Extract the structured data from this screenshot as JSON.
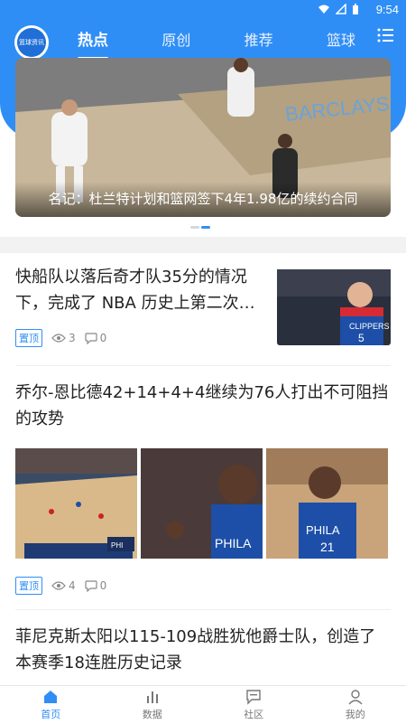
{
  "status": {
    "time": "9:54"
  },
  "header": {
    "logo_text": "篮球资讯",
    "tabs": [
      {
        "label": "热点",
        "active": true
      },
      {
        "label": "原创",
        "active": false
      },
      {
        "label": "推荐",
        "active": false
      },
      {
        "label": "篮球",
        "active": false
      }
    ]
  },
  "banner": {
    "caption": "名记：杜兰特计划和篮网签下4年1.98亿的续约合同",
    "pages": 2,
    "current": 1
  },
  "articles": [
    {
      "title_line1": "快船队以落后奇才队35分的情况",
      "title_line2": "下，完成了 NBA 历史上第二次…",
      "badge": "置顶",
      "views": "3",
      "comments": "0"
    },
    {
      "title_line1": "乔尔-恩比德42+14+4+4继续为76人打出不可阻挡",
      "title_line2": "的攻势",
      "badge": "置顶",
      "views": "4",
      "comments": "0"
    },
    {
      "title_line1": "菲尼克斯太阳以115-109战胜犹他爵士队，创造了",
      "title_line2": "本赛季18连胜历史记录"
    }
  ],
  "bottom_nav": [
    {
      "label": "首页",
      "icon": "home-icon",
      "active": true
    },
    {
      "label": "数据",
      "icon": "bar-chart-icon",
      "active": false
    },
    {
      "label": "社区",
      "icon": "chat-icon",
      "active": false
    },
    {
      "label": "我的",
      "icon": "user-icon",
      "active": false
    }
  ],
  "colors": {
    "accent": "#2f8ef6",
    "background": "#ffffff",
    "divider": "#f2f2f2"
  }
}
